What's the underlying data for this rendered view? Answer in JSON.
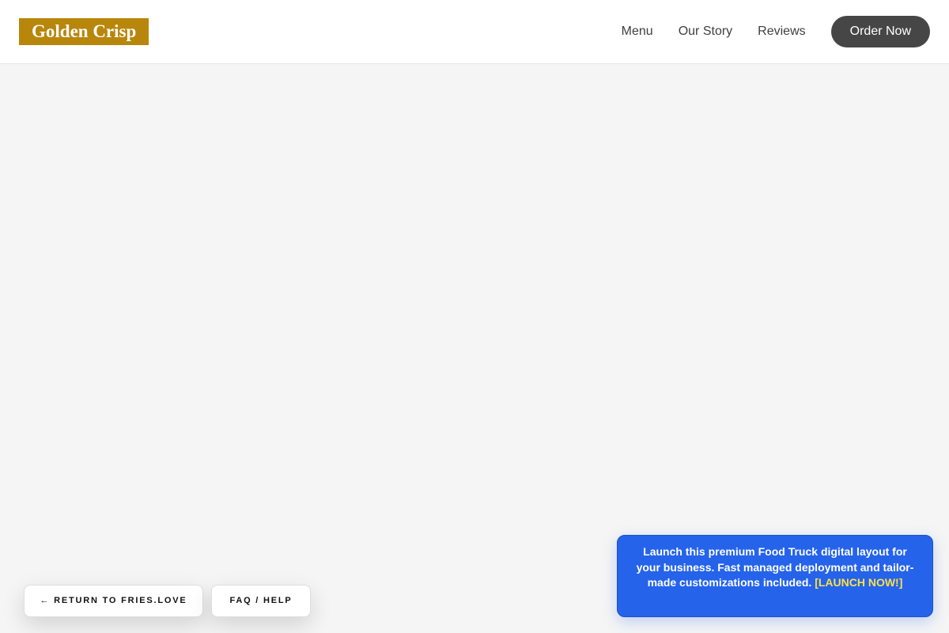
{
  "brand": {
    "name": "Golden Crisp",
    "color": "#b8860b"
  },
  "nav": {
    "items": [
      "Menu",
      "Our Story",
      "Reviews"
    ],
    "cta_label": "Order Now"
  },
  "footer_buttons": {
    "return_label": "← RETURN TO FRIES.LOVE",
    "faq_label": "FAQ / HELP"
  },
  "promo": {
    "text": "Launch this premium Food Truck digital layout for your business. Fast managed deployment and tailor-made customizations included.",
    "link_label": "[LAUNCH NOW!]",
    "background": "#2563eb",
    "link_color": "#fde047"
  }
}
